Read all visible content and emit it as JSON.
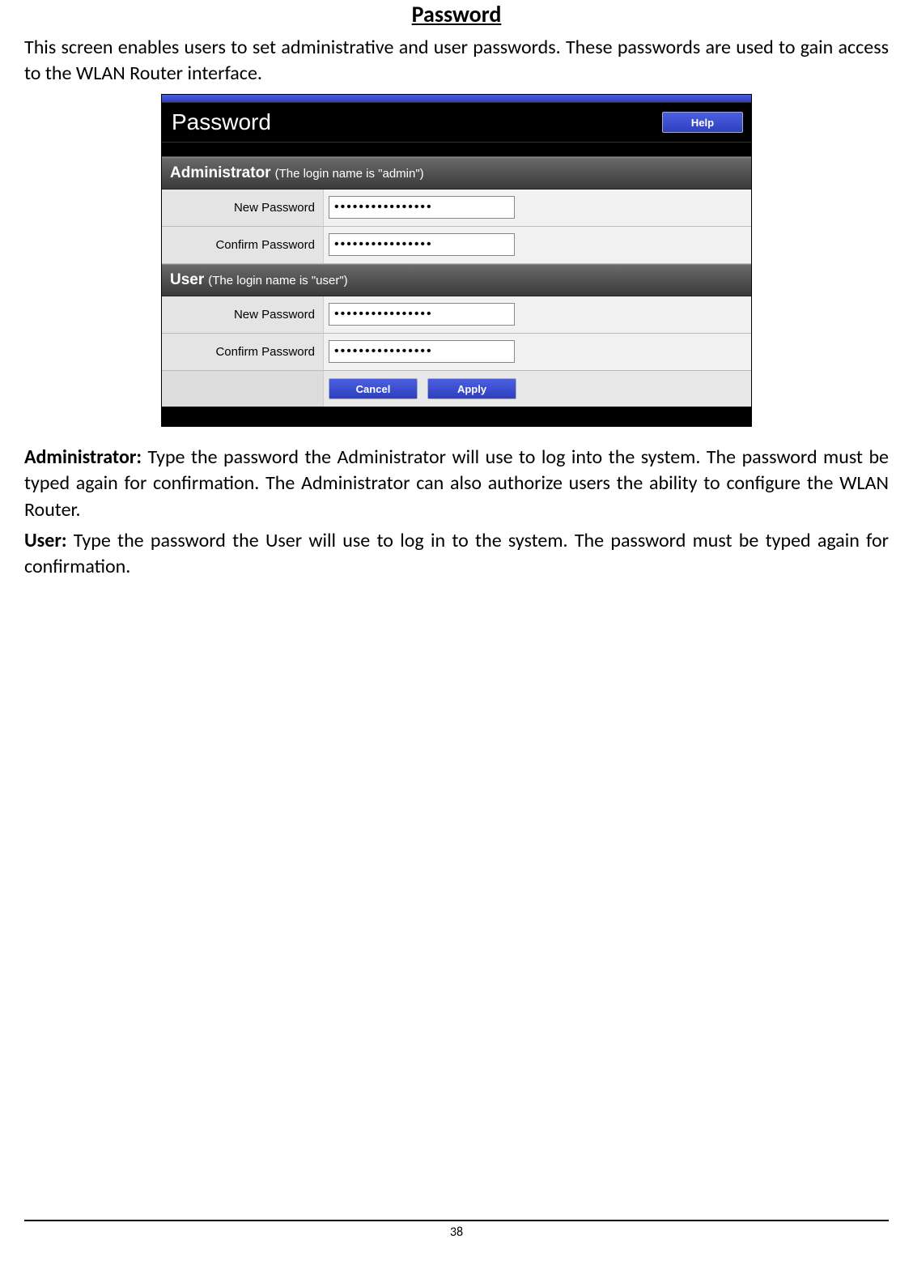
{
  "page": {
    "title": "Password",
    "intro": "This screen enables users to set administrative and user passwords. These passwords are used to gain access to the WLAN Router interface.",
    "pagenum": "38"
  },
  "screenshot": {
    "header_title": "Password",
    "help_label": "Help",
    "admin": {
      "section_label": "Administrator",
      "section_note": "(The login name is \"admin\")",
      "new_pw_label": "New Password",
      "confirm_pw_label": "Confirm Password",
      "new_pw_value": "••••••••••••••••",
      "confirm_pw_value": "••••••••••••••••"
    },
    "user": {
      "section_label": "User",
      "section_note": "(The login name is \"user\")",
      "new_pw_label": "New Password",
      "confirm_pw_label": "Confirm Password",
      "new_pw_value": "••••••••••••••••",
      "confirm_pw_value": "••••••••••••••••"
    },
    "cancel_label": "Cancel",
    "apply_label": "Apply"
  },
  "descriptions": {
    "admin_label": "Administrator:",
    "admin_text": " Type the password the Administrator will use to log into the system. The password must be typed again for confirmation. The Administrator can also authorize users the ability to configure the WLAN Router.",
    "user_label": "User:",
    "user_text": " Type the password the User will use to log in to the system. The password must be typed again for confirmation."
  }
}
